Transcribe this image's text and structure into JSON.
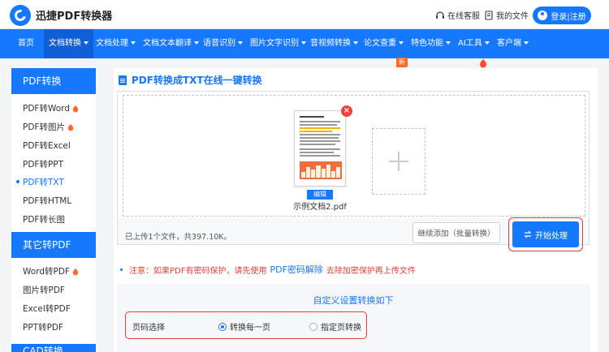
{
  "header": {
    "brand": "迅捷PDF转换器",
    "service_link": "在线客服",
    "files_link": "我的文件",
    "login_label": "登录|注册"
  },
  "nav": {
    "items": [
      {
        "label": "首页",
        "caret": false
      },
      {
        "label": "文档转换",
        "caret": true
      },
      {
        "label": "文档处理",
        "caret": true
      },
      {
        "label": "文档文本翻译",
        "caret": true
      },
      {
        "label": "语音识别",
        "caret": true
      },
      {
        "label": "图片文字识别",
        "caret": true
      },
      {
        "label": "音视频转换",
        "caret": true
      },
      {
        "label": "论文查重",
        "caret": true
      },
      {
        "label": "特色功能",
        "caret": true
      },
      {
        "label": "AI工具",
        "caret": true
      },
      {
        "label": "客户端",
        "caret": true
      }
    ],
    "new_badge": "新"
  },
  "sidebar": {
    "section1": "PDF转换",
    "items1": [
      "PDF转Word",
      "PDF转图片",
      "PDF转Excel",
      "PDF转PPT",
      "PDF转TXT",
      "PDF转HTML",
      "PDF转长图"
    ],
    "section2": "其它转PDF",
    "items2": [
      "Word转PDF",
      "图片转PDF",
      "Excel转PDF",
      "PPT转PDF"
    ],
    "section3": "CAD转换"
  },
  "main": {
    "title": "PDF转换成TXT在线一键转换",
    "file_name": "示例文档2.pdf",
    "edit_tag": "编辑",
    "upload_info": "已上传1个文件，共397.10K。",
    "continue_label": "继续添加（批量转换）",
    "start_label": "开始处理",
    "notice_prefix": "注意：如果PDF有密码保护，请先使用",
    "notice_link": "PDF密码解除",
    "notice_suffix": "去除加密保护再上传文件",
    "settings_title": "自定义设置转换如下",
    "page_select_label": "页码选择",
    "option_all": "转换每一页",
    "option_some": "指定页转换"
  },
  "colors": {
    "accent": "#1677ff",
    "danger": "#e0403a",
    "hot": "#ff6a2b"
  }
}
